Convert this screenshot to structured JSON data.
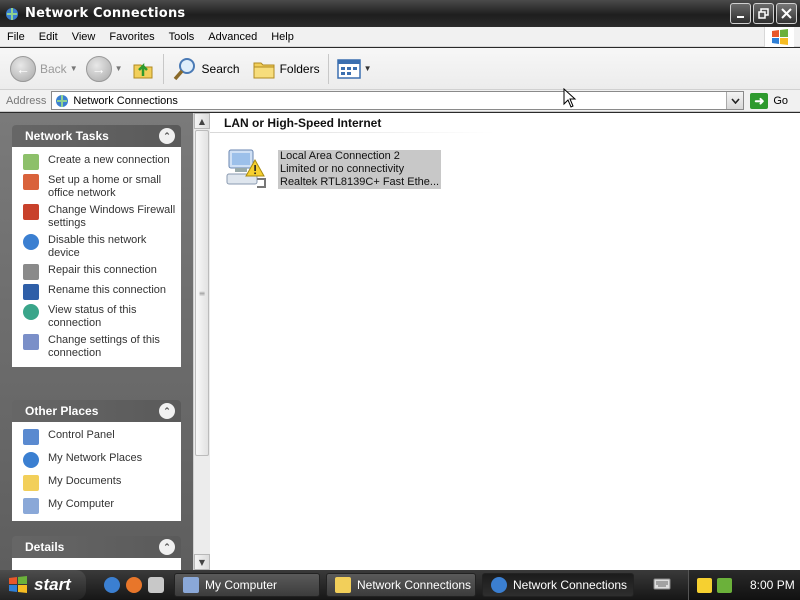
{
  "window": {
    "title": "Network Connections"
  },
  "menu": [
    "File",
    "Edit",
    "View",
    "Favorites",
    "Tools",
    "Advanced",
    "Help"
  ],
  "toolbar": {
    "back_label": "Back",
    "search_label": "Search",
    "folders_label": "Folders"
  },
  "address": {
    "label": "Address",
    "value": "Network Connections",
    "go_label": "Go"
  },
  "network_tasks": {
    "title": "Network Tasks",
    "items": [
      {
        "label": "Create a new connection",
        "icon": "new-connection-icon"
      },
      {
        "label": "Set up a home or small office network",
        "icon": "home-network-icon"
      },
      {
        "label": "Change Windows Firewall settings",
        "icon": "firewall-icon"
      },
      {
        "label": "Disable this network device",
        "icon": "disable-network-icon"
      },
      {
        "label": "Repair this connection",
        "icon": "repair-icon"
      },
      {
        "label": "Rename this connection",
        "icon": "rename-icon"
      },
      {
        "label": "View status of this connection",
        "icon": "status-icon"
      },
      {
        "label": "Change settings of this connection",
        "icon": "settings-icon"
      }
    ]
  },
  "other_places": {
    "title": "Other Places",
    "items": [
      {
        "label": "Control Panel",
        "icon": "control-panel-icon"
      },
      {
        "label": "My Network Places",
        "icon": "network-places-icon"
      },
      {
        "label": "My Documents",
        "icon": "my-documents-icon"
      },
      {
        "label": "My Computer",
        "icon": "my-computer-icon"
      }
    ]
  },
  "details": {
    "title": "Details"
  },
  "content": {
    "group_title": "LAN or High-Speed Internet",
    "connection": {
      "name": "Local Area Connection 2",
      "status": "Limited or no connectivity",
      "device": "Realtek RTL8139C+ Fast Ethe..."
    }
  },
  "taskbar": {
    "start_label": "start",
    "buttons": [
      {
        "label": "My Computer",
        "active": false
      },
      {
        "label": "Network Connections",
        "active": false
      },
      {
        "label": "Network Connections",
        "active": true
      }
    ],
    "clock": "8:00 PM"
  }
}
